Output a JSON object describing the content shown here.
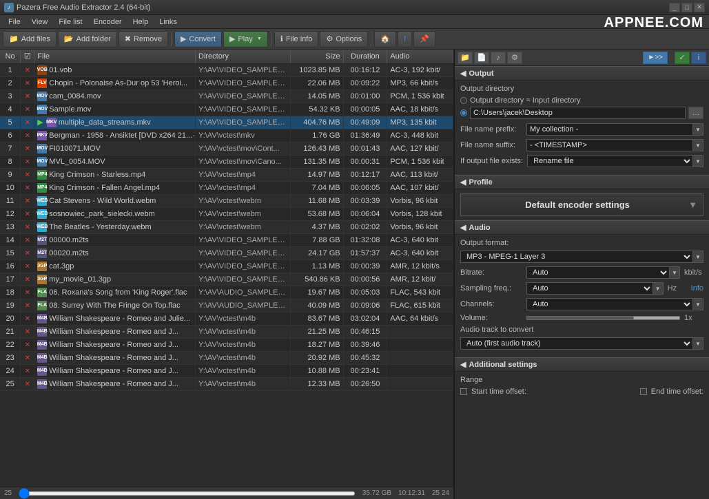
{
  "titleBar": {
    "title": "Pazera Free Audio Extractor 2.4 (64-bit)",
    "controls": [
      "_",
      "□",
      "✕"
    ]
  },
  "menuBar": {
    "items": [
      "File",
      "View",
      "File list",
      "Encoder",
      "Help",
      "Links"
    ]
  },
  "toolbar": {
    "addFiles": "Add files",
    "addFolder": "Add folder",
    "remove": "Remove",
    "convert": "Convert",
    "play": "Play",
    "fileInfo": "File info",
    "options": "Options"
  },
  "appneeLogo": "APPNEE.COM",
  "tableHeaders": {
    "no": "No",
    "check": "☑",
    "file": "File",
    "directory": "Directory",
    "size": "Size",
    "duration": "Duration",
    "audio": "Audio"
  },
  "files": [
    {
      "no": 1,
      "checked": true,
      "icon": "vob",
      "iconText": "VOB",
      "name": "01.vob",
      "dir": "Y:\\AV\\VIDEO_SAMPLES...",
      "size": "1023.85 MB",
      "duration": "00:16:12",
      "audio": "AC-3, 192 kbit/"
    },
    {
      "no": 2,
      "checked": true,
      "icon": "flv",
      "iconText": "FLV",
      "name": "Chopin - Polonaise As-Dur op 53 'Heroi...",
      "dir": "Y:\\AV\\VIDEO_SAMPLES...",
      "size": "22.06 MB",
      "duration": "00:09:22",
      "audio": "MP3, 66 kbit/s"
    },
    {
      "no": 3,
      "checked": true,
      "icon": "mov",
      "iconText": "MOV",
      "name": "cam_0084.mov",
      "dir": "Y:\\AV\\VIDEO_SAMPLES...",
      "size": "14.05 MB",
      "duration": "00:01:00",
      "audio": "PCM, 1 536 kbit"
    },
    {
      "no": 4,
      "checked": true,
      "icon": "mov",
      "iconText": "MOV",
      "name": "Sample.mov",
      "dir": "Y:\\AV\\VIDEO_SAMPLES...",
      "size": "54.32 KB",
      "duration": "00:00:05",
      "audio": "AAC, 18 kbit/s"
    },
    {
      "no": 5,
      "checked": true,
      "icon": "mkv",
      "iconText": "MKV",
      "name": "multiple_data_streams.mkv",
      "dir": "Y:\\AV\\VIDEO_SAMPLES...",
      "size": "404.76 MB",
      "duration": "00:49:09",
      "audio": "MP3, 135 kbit",
      "selected": true,
      "playing": true
    },
    {
      "no": 6,
      "checked": true,
      "icon": "mkv",
      "iconText": "MKV",
      "name": "Bergman - 1958 - Ansiktet [DVD x264 21...",
      "dir": "Y:\\AV\\vctest\\mkv",
      "size": "1.76 GB",
      "duration": "01:36:49",
      "audio": "AC-3, 448 kbit"
    },
    {
      "no": 7,
      "checked": true,
      "icon": "mov",
      "iconText": "MOV",
      "name": "FI010071.MOV",
      "dir": "Y:\\AV\\vctest\\mov\\Cont...",
      "size": "126.43 MB",
      "duration": "00:01:43",
      "audio": "AAC, 127 kbit/"
    },
    {
      "no": 8,
      "checked": true,
      "icon": "mov",
      "iconText": "MOV",
      "name": "MVL_0054.MOV",
      "dir": "Y:\\AV\\vctest\\mov\\Cano...",
      "size": "131.35 MB",
      "duration": "00:00:31",
      "audio": "PCM, 1 536 kbit"
    },
    {
      "no": 9,
      "checked": true,
      "icon": "mp4",
      "iconText": "MP4",
      "name": "King Crimson - Starless.mp4",
      "dir": "Y:\\AV\\vctest\\mp4",
      "size": "14.97 MB",
      "duration": "00:12:17",
      "audio": "AAC, 113 kbit/"
    },
    {
      "no": 10,
      "checked": true,
      "icon": "mp4",
      "iconText": "MP4",
      "name": "King Crimson - Fallen Angel.mp4",
      "dir": "Y:\\AV\\vctest\\mp4",
      "size": "7.04 MB",
      "duration": "00:06:05",
      "audio": "AAC, 107 kbit/"
    },
    {
      "no": 11,
      "checked": true,
      "icon": "webm",
      "iconText": "WEBM",
      "name": "Cat Stevens - Wild World.webm",
      "dir": "Y:\\AV\\vctest\\webm",
      "size": "11.68 MB",
      "duration": "00:03:39",
      "audio": "Vorbis, 96 kbit"
    },
    {
      "no": 12,
      "checked": true,
      "icon": "webm",
      "iconText": "WEBM",
      "name": "sosnowiec_park_sielecki.webm",
      "dir": "Y:\\AV\\vctest\\webm",
      "size": "53.68 MB",
      "duration": "00:06:04",
      "audio": "Vorbis, 128 kbit"
    },
    {
      "no": 13,
      "checked": true,
      "icon": "webm",
      "iconText": "WEBM",
      "name": "The Beatles - Yesterday.webm",
      "dir": "Y:\\AV\\vctest\\webm",
      "size": "4.37 MB",
      "duration": "00:02:02",
      "audio": "Vorbis, 96 kbit"
    },
    {
      "no": 14,
      "checked": true,
      "icon": "m2ts",
      "iconText": "M2TS",
      "name": "00000.m2ts",
      "dir": "Y:\\AV\\VIDEO_SAMPLES...",
      "size": "7.88 GB",
      "duration": "01:32:08",
      "audio": "AC-3, 640 kbit"
    },
    {
      "no": 15,
      "checked": true,
      "icon": "m2ts",
      "iconText": "M2TS",
      "name": "00020.m2ts",
      "dir": "Y:\\AV\\VIDEO_SAMPLES...",
      "size": "24.17 GB",
      "duration": "01:57:37",
      "audio": "AC-3, 640 kbit"
    },
    {
      "no": 16,
      "checked": true,
      "icon": "3gp",
      "iconText": "3GP",
      "name": "cat.3gp",
      "dir": "Y:\\AV\\VIDEO_SAMPLES...",
      "size": "1.13 MB",
      "duration": "00:00:39",
      "audio": "AMR, 12 kbit/s"
    },
    {
      "no": 17,
      "checked": true,
      "icon": "3gp",
      "iconText": "3GP",
      "name": "my_movie_01.3gp",
      "dir": "Y:\\AV\\VIDEO_SAMPLES...",
      "size": "540.86 KB",
      "duration": "00:00:56",
      "audio": "AMR, 12 kbit/"
    },
    {
      "no": 18,
      "checked": true,
      "icon": "flac",
      "iconText": "FLAC",
      "name": "06. Roxana's Song from 'King Roger'.flac",
      "dir": "Y:\\AV\\AUDIO_SAMPLES...",
      "size": "19.67 MB",
      "duration": "00:05:03",
      "audio": "FLAC, 543 kbit"
    },
    {
      "no": 19,
      "checked": true,
      "icon": "flac",
      "iconText": "FLAC",
      "name": "08. Surrey With The Fringe On Top.flac",
      "dir": "Y:\\AV\\AUDIO_SAMPLES...",
      "size": "40.09 MB",
      "duration": "00:09:06",
      "audio": "FLAC, 615 kbit"
    },
    {
      "no": 20,
      "checked": true,
      "icon": "m4b",
      "iconText": "M4B",
      "name": "William Shakespeare - Romeo and Julie...",
      "dir": "Y:\\AV\\vctest\\m4b",
      "size": "83.67 MB",
      "duration": "03:02:04",
      "audio": "AAC, 64 kbit/s"
    },
    {
      "no": 21,
      "checked": true,
      "icon": "m4b",
      "iconText": "M4B",
      "name": "William Shakespeare - Romeo and J...",
      "dir": "Y:\\AV\\vctest\\m4b",
      "size": "21.25 MB",
      "duration": "00:46:15",
      "audio": ""
    },
    {
      "no": 22,
      "checked": true,
      "icon": "m4b",
      "iconText": "M4B",
      "name": "William Shakespeare - Romeo and J...",
      "dir": "Y:\\AV\\vctest\\m4b",
      "size": "18.27 MB",
      "duration": "00:39:46",
      "audio": ""
    },
    {
      "no": 23,
      "checked": true,
      "icon": "m4b",
      "iconText": "M4B",
      "name": "William Shakespeare - Romeo and J...",
      "dir": "Y:\\AV\\vctest\\m4b",
      "size": "20.92 MB",
      "duration": "00:45:32",
      "audio": ""
    },
    {
      "no": 24,
      "checked": true,
      "icon": "m4b",
      "iconText": "M4B",
      "name": "William Shakespeare - Romeo and J...",
      "dir": "Y:\\AV\\vctest\\m4b",
      "size": "10.88 MB",
      "duration": "00:23:41",
      "audio": ""
    },
    {
      "no": 25,
      "checked": true,
      "icon": "m4b",
      "iconText": "M4B",
      "name": "William Shakespeare - Romeo and J...",
      "dir": "Y:\\AV\\vctest\\m4b",
      "size": "12.33 MB",
      "duration": "00:26:50",
      "audio": ""
    }
  ],
  "statusBar": {
    "total": "25",
    "totalSize": "35.72 GB",
    "totalDuration": "10:12:31",
    "page": "25  24"
  },
  "rightPanel": {
    "toolbarButtons": [
      "folder-icon",
      "file-icon",
      "music-icon",
      "gear-icon"
    ],
    "arrowLabel": ">>>",
    "output": {
      "sectionLabel": "Output",
      "outputDirLabel": "Output directory",
      "option1": "Output directory = Input directory",
      "option2": "C:\\Users\\jacek\\Desktop",
      "fileNamePrefixLabel": "File name prefix:",
      "fileNamePrefixValue": "My collection -",
      "fileNameSuffixLabel": "File name suffix:",
      "fileNameSuffixValue": "- <TIMESTAMP>",
      "ifOutputExistsLabel": "If output file exists:",
      "ifOutputExistsValue": "Rename file"
    },
    "profile": {
      "sectionLabel": "Profile",
      "profileValue": "Default encoder settings"
    },
    "audio": {
      "sectionLabel": "Audio",
      "outputFormatLabel": "Output format:",
      "outputFormatValue": "MP3 - MPEG-1 Layer 3",
      "bitrateLabel": "Bitrate:",
      "bitrateValue": "Auto",
      "bitrateUnit": "kbit/s",
      "samplingLabel": "Sampling freq.:",
      "samplingValue": "Auto",
      "samplingUnit": "Hz",
      "infoLabel": "Info",
      "channelsLabel": "Channels:",
      "channelsValue": "Auto",
      "volumeLabel": "Volume:",
      "volumeValue": "1x",
      "audioTrackLabel": "Audio track to convert",
      "audioTrackValue": "Auto (first audio track)"
    },
    "additionalSettings": {
      "sectionLabel": "Additional settings",
      "rangeLabel": "Range",
      "startTimeLabel": "Start time offset:",
      "endTimeLabel": "End time offset:"
    }
  }
}
